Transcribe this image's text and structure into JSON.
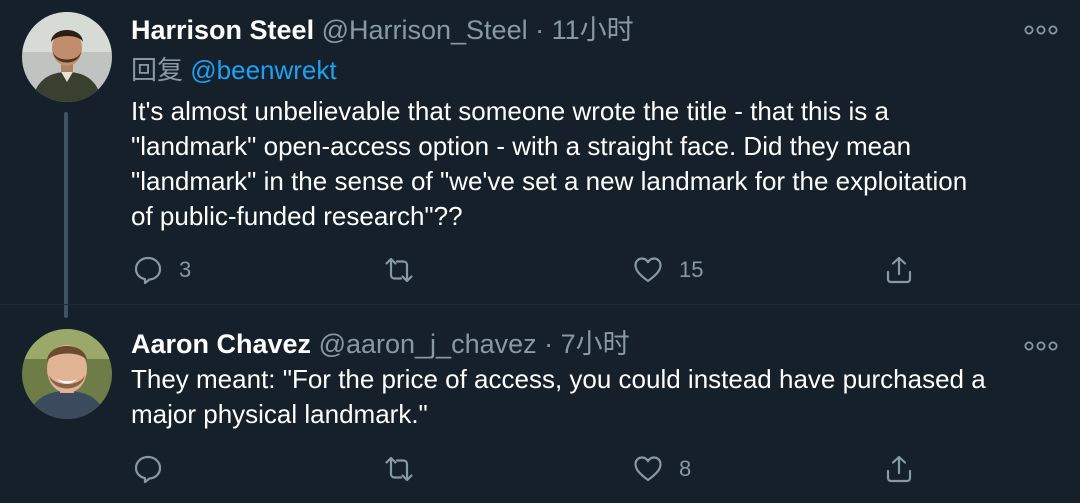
{
  "tweets": [
    {
      "display_name": "Harrison Steel",
      "handle": "@Harrison_Steel",
      "separator": "·",
      "time": "11小时",
      "reply_prefix": "回复",
      "reply_to": "@beenwrekt",
      "text_lines": [
        "It's almost unbelievable that someone wrote the title - that this is a",
        "\"landmark\" open-access option - with a straight face. Did they mean",
        "\"landmark\" in the sense of \"we've set a new landmark for the exploitation",
        "of public-funded research\"??"
      ],
      "replies": "3",
      "retweets": "",
      "likes": "15"
    },
    {
      "display_name": "Aaron Chavez",
      "handle": "@aaron_j_chavez",
      "separator": "·",
      "time": "7小时",
      "text_lines": [
        "They meant: \"For the price of access, you could instead have purchased a",
        "major physical landmark.\""
      ],
      "replies": "",
      "retweets": "",
      "likes": "8"
    }
  ],
  "icons": {
    "reply": "speech-bubble-icon",
    "retweet": "retweet-arrows-icon",
    "like": "heart-icon",
    "share": "share-upload-icon",
    "more": "more-dots-icon"
  },
  "colors": {
    "background": "#15202b",
    "text": "#ffffff",
    "secondary_text": "#8899a6",
    "link": "#1da1f2",
    "thread_line": "#3d5466"
  }
}
